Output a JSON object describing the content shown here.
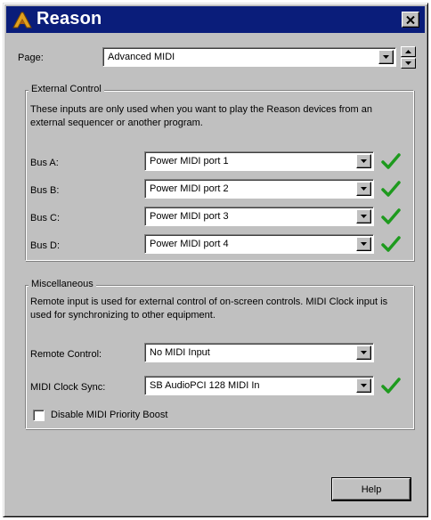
{
  "window": {
    "title": "Reason"
  },
  "page": {
    "label": "Page:",
    "value": "Advanced MIDI"
  },
  "external_control": {
    "title": "External Control",
    "description": "These inputs are only used when you want to play the Reason devices from an external sequencer or another program.",
    "buses": [
      {
        "label": "Bus A:",
        "value": "Power MIDI port 1"
      },
      {
        "label": "Bus B:",
        "value": "Power MIDI port 2"
      },
      {
        "label": "Bus C:",
        "value": "Power MIDI port 3"
      },
      {
        "label": "Bus D:",
        "value": "Power MIDI port 4"
      }
    ]
  },
  "miscellaneous": {
    "title": "Miscellaneous",
    "description": "Remote input is used for external control of on-screen controls. MIDI Clock input is used for synchronizing to other equipment.",
    "remote_control": {
      "label": "Remote Control:",
      "value": "No MIDI Input"
    },
    "midi_clock_sync": {
      "label": "MIDI Clock Sync:",
      "value": "SB AudioPCI 128 MIDI In"
    },
    "disable_priority_boost": {
      "label": "Disable MIDI Priority Boost",
      "checked": false
    }
  },
  "buttons": {
    "help": "Help"
  },
  "colors": {
    "titlebar": "#0a1d7a",
    "face": "#c0c0c0",
    "check": "#1e9a1e"
  }
}
